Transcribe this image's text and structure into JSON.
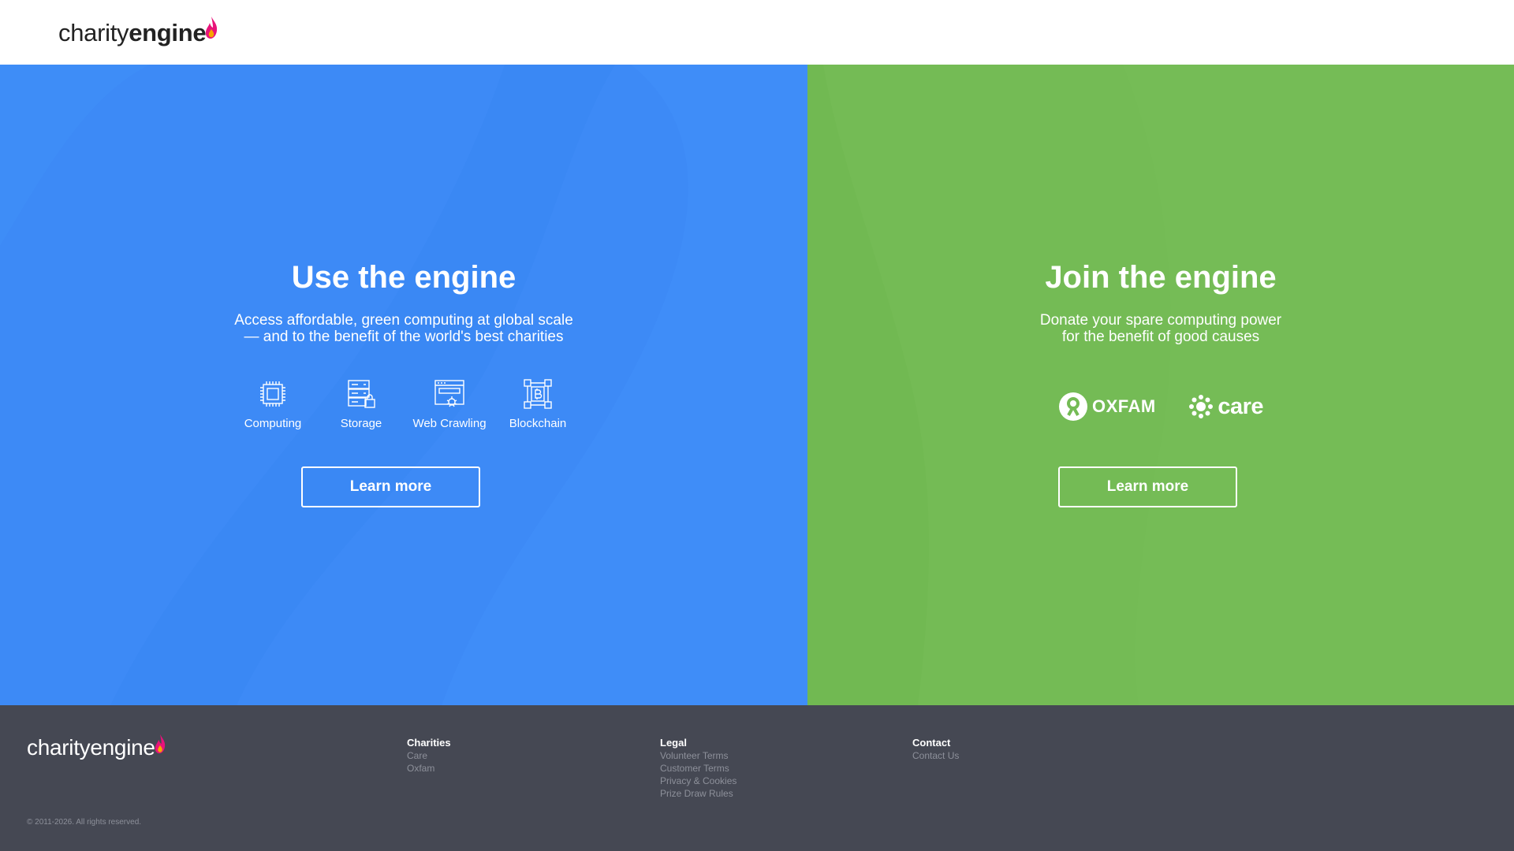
{
  "brand": {
    "name_light": "charity",
    "name_bold": "engine",
    "flame_colors": [
      "#e8137a",
      "#f7a600"
    ]
  },
  "left_panel": {
    "title": "Use the engine",
    "subtitle_line1": "Access affordable, green computing at global scale",
    "subtitle_line2": "— and to the benefit of the world's best charities",
    "services": [
      {
        "label": "Computing",
        "icon": "cpu-chip-icon"
      },
      {
        "label": "Storage",
        "icon": "storage-server-icon"
      },
      {
        "label": "Web Crawling",
        "icon": "web-crawler-icon"
      },
      {
        "label": "Blockchain",
        "icon": "blockchain-icon"
      }
    ],
    "button_label": "Learn more",
    "bg_color": "#3d8af6"
  },
  "right_panel": {
    "title": "Join the engine",
    "subtitle_line1": "Donate your spare computing power",
    "subtitle_line2": "for the benefit of good causes",
    "partners": [
      {
        "label": "OXFAM",
        "icon": "oxfam-logo-icon"
      },
      {
        "label": "care",
        "icon": "care-logo-icon"
      }
    ],
    "button_label": "Learn more",
    "bg_color": "#74bb55"
  },
  "footer": {
    "columns": [
      {
        "title": "Charities",
        "links": [
          "Care",
          "Oxfam"
        ]
      },
      {
        "title": "Legal",
        "links": [
          "Volunteer Terms",
          "Customer Terms",
          "Privacy & Cookies",
          "Prize Draw Rules"
        ]
      },
      {
        "title": "Contact",
        "links": [
          "Contact Us"
        ]
      }
    ],
    "copyright": "© 2011-2026. All rights reserved.",
    "bg_color": "#454853"
  }
}
